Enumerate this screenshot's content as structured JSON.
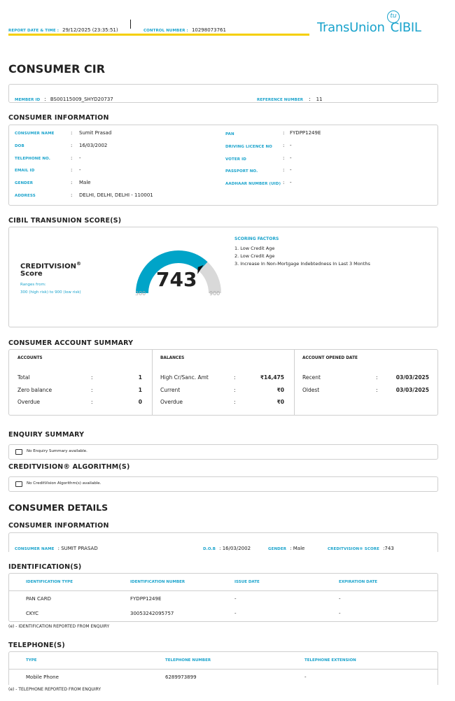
{
  "header": {
    "report_date_label": "REPORT DATE & TIME :",
    "report_date": "29/12/2025 (23:35:51)",
    "control_label": "CONTROL NUMBER :",
    "control_number": "10298073761",
    "logo_text": "TransUnion CIBIL",
    "logo_badge": "tu"
  },
  "title": "CONSUMER CIR",
  "member": {
    "member_label": "MEMBER ID",
    "member_id": "BS00115009_SHYD20737",
    "ref_label": "REFERENCE NUMBER",
    "ref": "11"
  },
  "consumer_info": {
    "heading": "CONSUMER INFORMATION",
    "left": [
      {
        "label": "CONSUMER NAME",
        "value": "Sumit Prasad"
      },
      {
        "label": "DOB",
        "value": "16/03/2002"
      },
      {
        "label": "TELEPHONE NO.",
        "value": "-"
      },
      {
        "label": "EMAIL ID",
        "value": "-"
      },
      {
        "label": "GENDER",
        "value": "Male"
      },
      {
        "label": "ADDRESS",
        "value": "DELHI, DELHI, DELHI - 110001"
      }
    ],
    "right": [
      {
        "label": "PAN",
        "value": "FYDPP1249E"
      },
      {
        "label": "DRIVING LICENCE NO",
        "value": "-"
      },
      {
        "label": "VOTER ID",
        "value": "-"
      },
      {
        "label": "PASSPORT NO.",
        "value": "-"
      },
      {
        "label": "AADHAAR NUMBER (UID)",
        "value": "-"
      }
    ]
  },
  "score": {
    "heading": "CIBIL TRANSUNION SCORE(S)",
    "name": "CREDITVISION",
    "reg": "®",
    "sub": "Score",
    "range_label": "Ranges from:",
    "range": "300 (high risk) to 900 (low risk)",
    "value": 743,
    "value_text": "743",
    "min": "300",
    "max": "900",
    "min_v": 300,
    "max_v": 900,
    "colors": {
      "fill": "#00a4c8",
      "rest": "#d9d9d9"
    },
    "factors_label": "SCORING FACTORS",
    "factors": [
      "1. Low Credit Age",
      "2. Low Credit Age",
      "3. Increase In Non-Mortgage Indebtedness In Last 3 Months"
    ]
  },
  "account_summary": {
    "heading": "CONSUMER ACCOUNT SUMMARY",
    "accounts": {
      "title": "ACCOUNTS",
      "rows": [
        {
          "k": "Total",
          "v": "1"
        },
        {
          "k": "Zero balance",
          "v": "1"
        },
        {
          "k": "Overdue",
          "v": "0"
        }
      ]
    },
    "balances": {
      "title": "BALANCES",
      "rows": [
        {
          "k": "High Cr/Sanc. Amt",
          "v": "₹14,475"
        },
        {
          "k": "Current",
          "v": "₹0"
        },
        {
          "k": "Overdue",
          "v": "₹0"
        }
      ]
    },
    "opened": {
      "title": "ACCOUNT OPENED DATE",
      "rows": [
        {
          "k": "Recent",
          "v": "03/03/2025"
        },
        {
          "k": "Oldest",
          "v": "03/03/2025"
        }
      ]
    }
  },
  "enquiry": {
    "heading": "ENQUIRY SUMMARY",
    "message": "No Enquiry Summary available."
  },
  "algorithm": {
    "heading": "CREDITVISION® ALGORITHM(S)",
    "message": "No CreditVision Algorithm(s) available."
  },
  "details": {
    "heading": "CONSUMER DETAILS",
    "info_heading": "CONSUMER INFORMATION",
    "name_label": "CONSUMER NAME",
    "name": "SUMIT PRASAD",
    "dob_label": "D.O.B",
    "dob": "16/03/2002",
    "gender_label": "GENDER",
    "gender": "Male",
    "score_label": "CREDITVISION® SCORE",
    "score": "743"
  },
  "identifications": {
    "heading": "IDENTIFICATION(S)",
    "columns": [
      "IDENTIFICATION TYPE",
      "IDENTIFICATION NUMBER",
      "ISSUE DATE",
      "EXPIRATION DATE"
    ],
    "rows": [
      [
        "PAN CARD",
        "FYDPP1249E",
        "-",
        "-"
      ],
      [
        "CKYC",
        "30053242095757",
        "-",
        "-"
      ]
    ],
    "note": "(e) - IDENTIFICATION REPORTED FROM ENQUIRY"
  },
  "telephones": {
    "heading": "TELEPHONE(S)",
    "columns": [
      "TYPE",
      "TELEPHONE NUMBER",
      "TELEPHONE EXTENSION"
    ],
    "rows": [
      [
        "Mobile Phone",
        "6289973899",
        "-"
      ]
    ],
    "note": "(e) - TELEPHONE REPORTED FROM ENQUIRY"
  }
}
